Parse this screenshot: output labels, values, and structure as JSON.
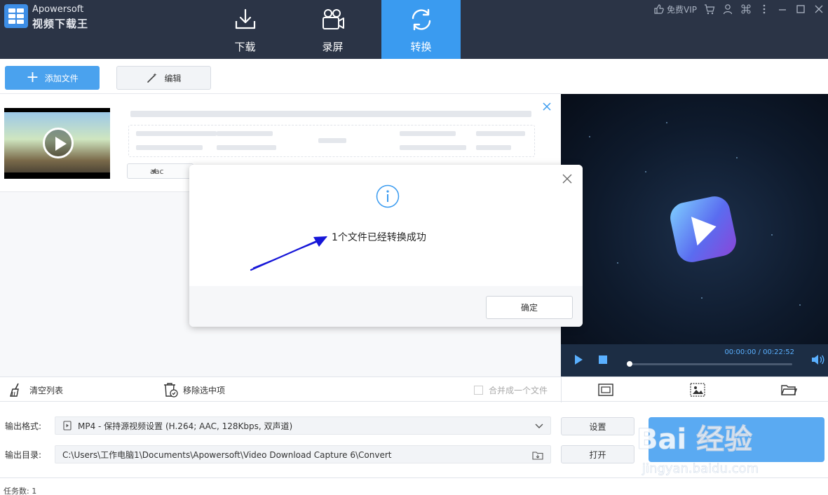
{
  "app": {
    "brand_en": "Apowersoft",
    "brand_cn": "视频下载王",
    "accent": "#3a9bf0",
    "header_bg": "#2b3446"
  },
  "tabs": [
    {
      "label": "下载",
      "icon": "download-icon",
      "active": false
    },
    {
      "label": "录屏",
      "icon": "video-camera-icon",
      "active": false
    },
    {
      "label": "转换",
      "icon": "convert-icon",
      "active": true
    }
  ],
  "window_controls": {
    "vip_label": "免费VIP"
  },
  "toolbar": {
    "add_file_label": "添加文件",
    "edit_label": "编辑"
  },
  "file": {
    "audio_codec": "aac"
  },
  "player": {
    "time": "00:00:00 / 00:22:52",
    "progress": 0.0
  },
  "actions": {
    "clear_list": "清空列表",
    "remove_selected": "移除选中项",
    "merge_label": "合并成一个文件",
    "merge_checked": false
  },
  "output": {
    "format_label": "输出格式:",
    "format_value": "MP4 - 保持源视频设置 (H.264; AAC, 128Kbps, 双声道)",
    "dir_label": "输出目录:",
    "dir_value": "C:\\Users\\工作电脑1\\Documents\\Apowersoft\\Video Download Capture 6\\Convert",
    "settings_btn": "设置",
    "open_btn": "打开"
  },
  "status": {
    "task_count": "任务数: 1"
  },
  "dialog": {
    "message": "1个文件已经转换成功",
    "ok_label": "确定"
  },
  "watermark": {
    "text": "Bai  经验",
    "url": "jingyan.baidu.com"
  }
}
